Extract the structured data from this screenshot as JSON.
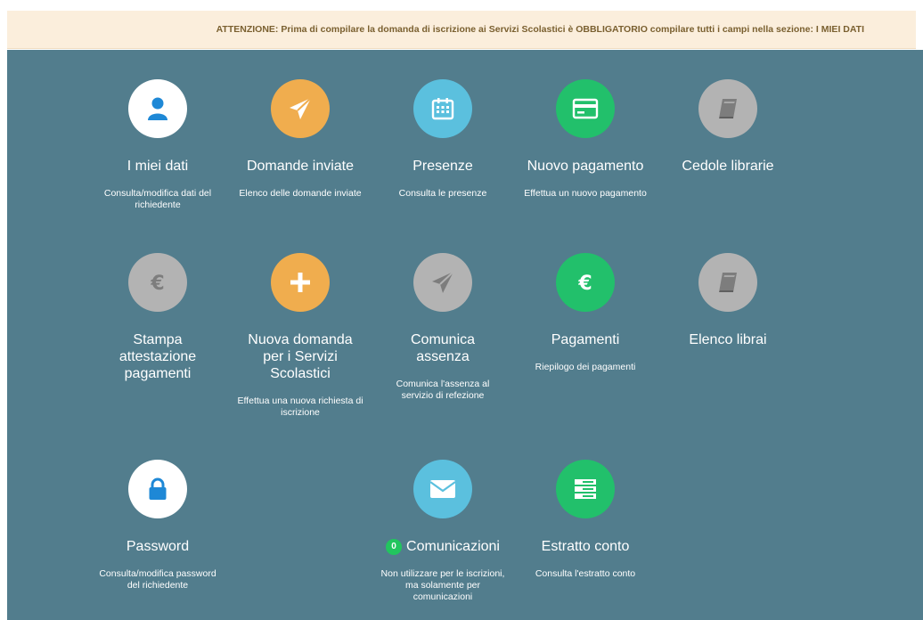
{
  "alert": {
    "text": "ATTENZIONE: Prima di compilare la domanda di iscrizione ai Servizi Scolastici è OBBLIGATORIO compilare tutti i campi nella sezione: I MIEI DATI"
  },
  "tiles": [
    {
      "title": "I miei dati",
      "desc": "Consulta/modifica dati del richiedente",
      "icon": "user-icon",
      "color": "#ffffff"
    },
    {
      "title": "Domande inviate",
      "desc": "Elenco delle domande inviate",
      "icon": "paper-plane-icon",
      "color": "#f0ad4e"
    },
    {
      "title": "Presenze",
      "desc": "Consulta le presenze",
      "icon": "calendar-icon",
      "color": "#5bc0de"
    },
    {
      "title": "Nuovo pagamento",
      "desc": "Effettua un nuovo pagamento",
      "icon": "credit-card-icon",
      "color": "#22c06b"
    },
    {
      "title": "Cedole librarie",
      "desc": "",
      "icon": "book-icon",
      "color": "#b3b3b3"
    },
    {
      "title": "Stampa attestazione pagamenti",
      "desc": "",
      "icon": "euro-icon",
      "color": "#b3b3b3"
    },
    {
      "title": "Nuova domanda per i Servizi Scolastici",
      "desc": "Effettua una nuova richiesta di iscrizione",
      "icon": "plus-icon",
      "color": "#f0ad4e"
    },
    {
      "title": "Comunica assenza",
      "desc": "Comunica l'assenza al servizio di refezione",
      "icon": "paper-plane-icon",
      "color": "#b3b3b3"
    },
    {
      "title": "Pagamenti",
      "desc": "Riepilogo dei pagamenti",
      "icon": "euro-icon",
      "color": "#22c06b"
    },
    {
      "title": "Elenco librai",
      "desc": "",
      "icon": "book-icon",
      "color": "#b3b3b3"
    },
    {
      "title": "Password",
      "desc": "Consulta/modifica password del richiedente",
      "icon": "lock-icon",
      "color": "#ffffff"
    },
    {
      "title": "Comunicazioni",
      "desc": "Non utilizzare per le iscrizioni, ma solamente per comunicazioni",
      "icon": "envelope-icon",
      "color": "#5bc0de",
      "badge": "0"
    },
    {
      "title": "Estratto conto",
      "desc": "Consulta l'estratto conto",
      "icon": "list-icon",
      "color": "#22c06b"
    }
  ]
}
